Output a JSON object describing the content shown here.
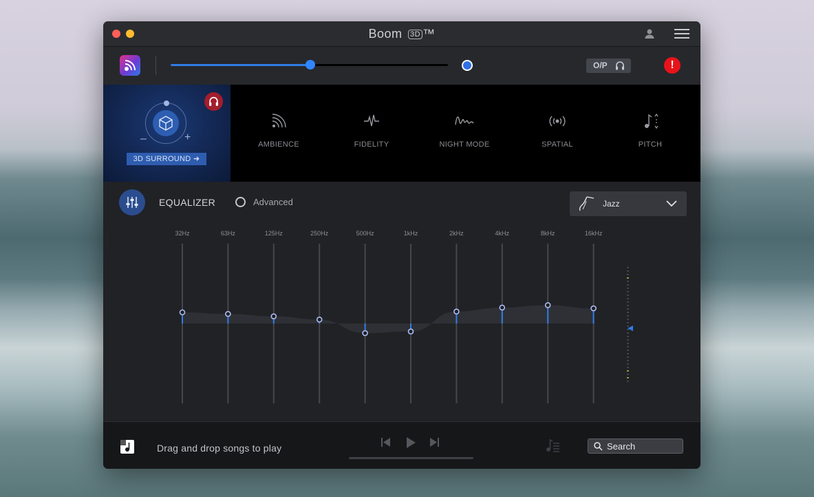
{
  "app": {
    "title": "Boom",
    "badge": "3D",
    "trademark": "™"
  },
  "colors": {
    "accent": "#2f7de6",
    "alert": "#e8131b",
    "close": "#fe5f57",
    "minimize": "#febc2e"
  },
  "toolbar": {
    "volume_fraction": 0.503,
    "output_label": "O/P",
    "alert_label": "!"
  },
  "surround": {
    "button_label": "3D SURROUND ➜",
    "minus": "–",
    "plus": "+"
  },
  "effects": [
    {
      "label": "AMBIENCE",
      "icon": "ambience-icon"
    },
    {
      "label": "FIDELITY",
      "icon": "fidelity-icon"
    },
    {
      "label": "NIGHT MODE",
      "icon": "night-mode-icon"
    },
    {
      "label": "SPATIAL",
      "icon": "spatial-icon"
    },
    {
      "label": "PITCH",
      "icon": "pitch-icon"
    }
  ],
  "equalizer": {
    "title": "EQUALIZER",
    "advanced_label": "Advanced",
    "advanced_checked": false,
    "preset": "Jazz",
    "band_range": [
      -1,
      1
    ],
    "bands": [
      {
        "label": "32Hz",
        "value": 0.14
      },
      {
        "label": "63Hz",
        "value": 0.12
      },
      {
        "label": "125Hz",
        "value": 0.09
      },
      {
        "label": "250Hz",
        "value": 0.05
      },
      {
        "label": "500Hz",
        "value": -0.12
      },
      {
        "label": "1kHz",
        "value": -0.1
      },
      {
        "label": "2kHz",
        "value": 0.15
      },
      {
        "label": "4kHz",
        "value": 0.2
      },
      {
        "label": "8kHz",
        "value": 0.23
      },
      {
        "label": "16kHz",
        "value": 0.19
      }
    ]
  },
  "footer": {
    "drop_text": "Drag and drop songs to play",
    "search_placeholder": "Search"
  }
}
